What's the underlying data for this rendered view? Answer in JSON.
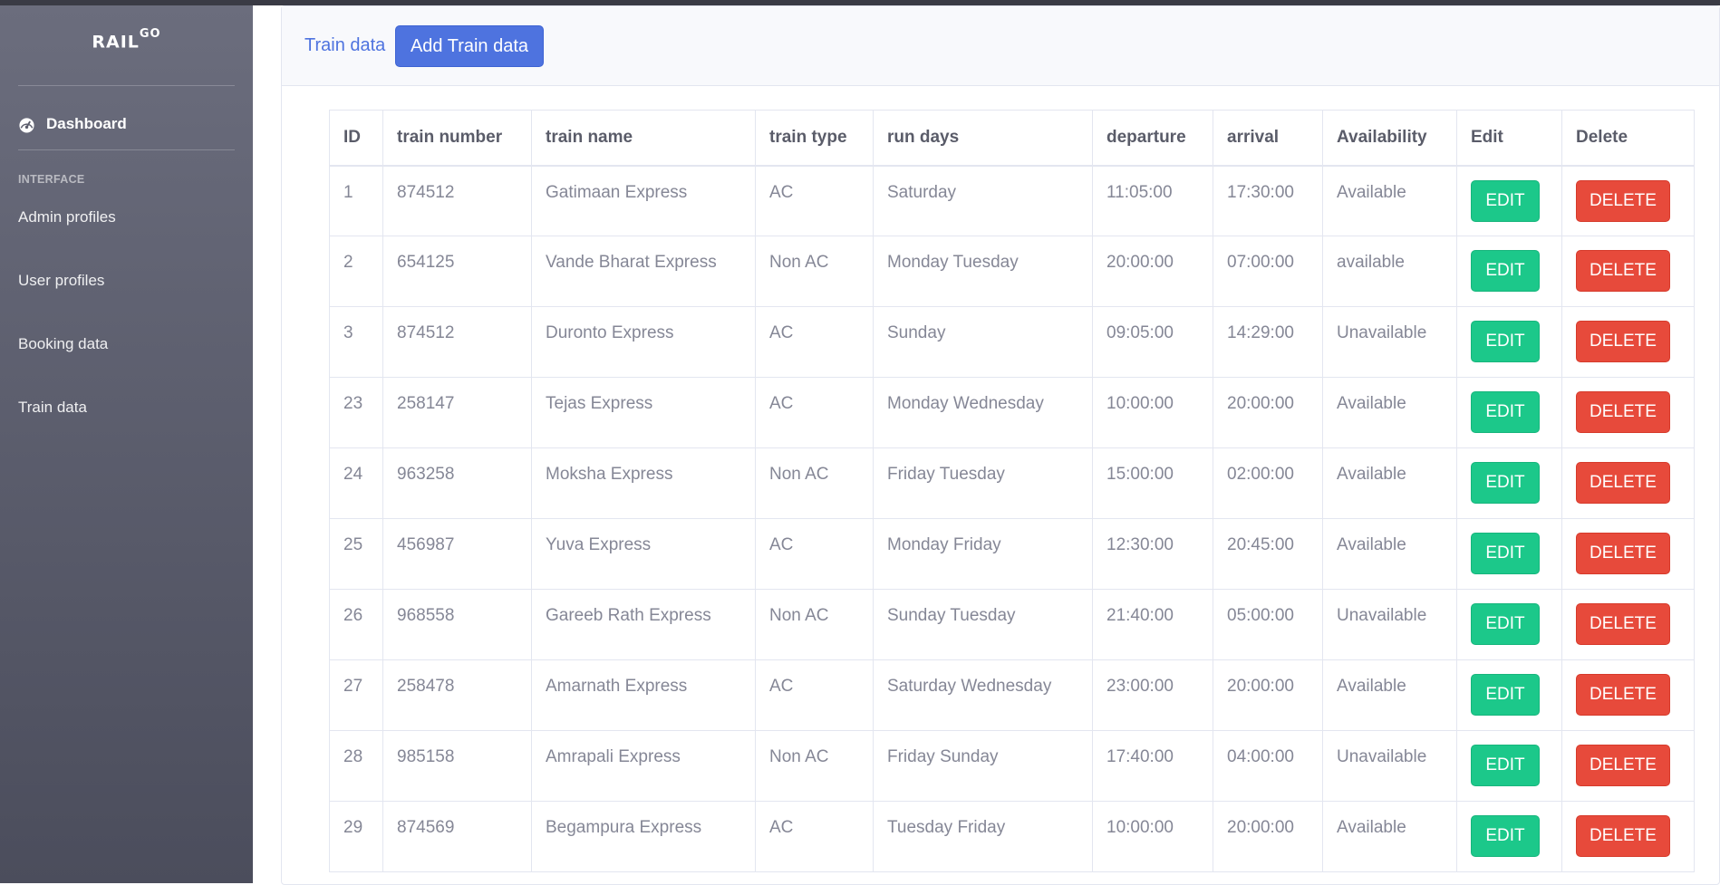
{
  "brand": {
    "name": "RAIL",
    "superscript": "GO"
  },
  "sidebar": {
    "dashboard_label": "Dashboard",
    "section_label": "INTERFACE",
    "items": [
      {
        "label": "Admin profiles"
      },
      {
        "label": "User profiles"
      },
      {
        "label": "Booking data"
      },
      {
        "label": "Train data"
      }
    ]
  },
  "header": {
    "title": "Train data",
    "add_button_label": "Add Train data"
  },
  "table": {
    "columns": [
      "ID",
      "train number",
      "train name",
      "train type",
      "run days",
      "departure",
      "arrival",
      "Availability",
      "Edit",
      "Delete"
    ],
    "edit_label": "EDIT",
    "delete_label": "DELETE",
    "rows": [
      {
        "id": "1",
        "number": "874512",
        "name": "Gatimaan Express",
        "type": "AC",
        "days": "Saturday",
        "departure": "11:05:00",
        "arrival": "17:30:00",
        "availability": "Available"
      },
      {
        "id": "2",
        "number": "654125",
        "name": "Vande Bharat Express",
        "type": "Non AC",
        "days": "Monday Tuesday",
        "departure": "20:00:00",
        "arrival": "07:00:00",
        "availability": "available"
      },
      {
        "id": "3",
        "number": "874512",
        "name": "Duronto Express",
        "type": "AC",
        "days": "Sunday",
        "departure": "09:05:00",
        "arrival": "14:29:00",
        "availability": "Unavailable"
      },
      {
        "id": "23",
        "number": "258147",
        "name": "Tejas Express",
        "type": "AC",
        "days": "Monday Wednesday",
        "departure": "10:00:00",
        "arrival": "20:00:00",
        "availability": "Available"
      },
      {
        "id": "24",
        "number": "963258",
        "name": "Moksha Express",
        "type": "Non AC",
        "days": "Friday Tuesday",
        "departure": "15:00:00",
        "arrival": "02:00:00",
        "availability": "Available"
      },
      {
        "id": "25",
        "number": "456987",
        "name": "Yuva Express",
        "type": "AC",
        "days": "Monday Friday",
        "departure": "12:30:00",
        "arrival": "20:45:00",
        "availability": "Available"
      },
      {
        "id": "26",
        "number": "968558",
        "name": "Gareeb Rath Express",
        "type": "Non AC",
        "days": "Sunday Tuesday",
        "departure": "21:40:00",
        "arrival": "05:00:00",
        "availability": "Unavailable"
      },
      {
        "id": "27",
        "number": "258478",
        "name": "Amarnath Express",
        "type": "AC",
        "days": "Saturday Wednesday",
        "departure": "23:00:00",
        "arrival": "20:00:00",
        "availability": "Available"
      },
      {
        "id": "28",
        "number": "985158",
        "name": "Amrapali Express",
        "type": "Non AC",
        "days": "Friday Sunday",
        "departure": "17:40:00",
        "arrival": "04:00:00",
        "availability": "Unavailable"
      },
      {
        "id": "29",
        "number": "874569",
        "name": "Begampura Express",
        "type": "AC",
        "days": "Tuesday Friday",
        "departure": "10:00:00",
        "arrival": "20:00:00",
        "availability": "Available"
      }
    ]
  },
  "colors": {
    "primary": "#4e73df",
    "success": "#1cc88a",
    "danger": "#e74a3b",
    "sidebar_top": "#6b6d7d",
    "sidebar_bottom": "#4b4d5c"
  },
  "icons": {
    "dashboard": "tachometer-icon"
  }
}
